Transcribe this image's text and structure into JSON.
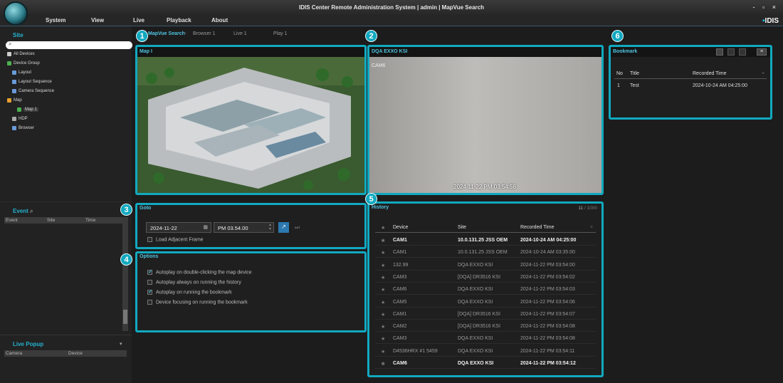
{
  "window": {
    "title": "IDIS Center Remote Administration System | admin | MapVue Search",
    "controls": "- ▫ ×",
    "brand": "IDIS"
  },
  "menu": [
    "System",
    "View",
    "Live",
    "Playback",
    "About"
  ],
  "site": {
    "title": "Site",
    "search_placeholder": "",
    "tree": [
      {
        "label": "All Devices",
        "icon_color": "#cccccc"
      },
      {
        "label": "Device Group",
        "icon_color": "#4caf50"
      },
      {
        "label": "Layout",
        "icon_color": "#6a9ad8"
      },
      {
        "label": "Layout Sequence",
        "icon_color": "#6a9ad8"
      },
      {
        "label": "Camera Sequence",
        "icon_color": "#6a9ad8"
      },
      {
        "label": "Map",
        "icon_color": "#e8a030"
      },
      {
        "label": "Map 1",
        "icon_color": "#4caf50"
      },
      {
        "label": "HDP",
        "icon_color": "#aaaaaa"
      },
      {
        "label": "Browser",
        "icon_color": "#6a9ad8"
      }
    ]
  },
  "event": {
    "title": "Event",
    "columns": [
      "Event",
      "Site",
      "Time"
    ]
  },
  "live_popup": {
    "title": "Live Popup",
    "columns": [
      "Camera",
      "Device"
    ]
  },
  "tabs": [
    "MapVue Search",
    "Browser 1",
    "Live 1",
    "Play 1"
  ],
  "map_panel": {
    "badge": "1",
    "title": "Map I"
  },
  "video_panel": {
    "badge": "2",
    "title": "DQA EXXO KSI",
    "camera_label": "CAM6",
    "timestamp": "2024-11-22 PM 03:54:56"
  },
  "goto_panel": {
    "badge": "3",
    "title": "Goto",
    "date": "2024-11-22",
    "time": "PM 03.54.00",
    "load_adjacent": "Load Adjacent Frame"
  },
  "options_panel": {
    "badge": "4",
    "title": "Options",
    "items": [
      {
        "label": "Autoplay on double-clicking the map device",
        "checked": true
      },
      {
        "label": "Autoplay always on running the history",
        "checked": false
      },
      {
        "label": "Autoplay on running the bookmark",
        "checked": true
      },
      {
        "label": "Device focusing on running the bookmark",
        "checked": false
      }
    ]
  },
  "history_panel": {
    "badge": "5",
    "title": "History",
    "count": "11",
    "total": "/ 1000",
    "columns": [
      "Device",
      "Site",
      "Recorded Time"
    ],
    "rows": [
      {
        "device": "CAM1",
        "site": "10.0.131.25 JSS OEM",
        "time": "2024-10-24 AM 04:25:00",
        "bold": true
      },
      {
        "device": "CAM1",
        "site": "10.0.131.25 JSS OEM",
        "time": "2024-10-24 AM 03:35:00",
        "bold": false
      },
      {
        "device": "132.99",
        "site": "DQA EXXO KSI",
        "time": "2024-11-22 PM 03:54:00",
        "bold": false
      },
      {
        "device": "CAM3",
        "site": "[DQA] DR3516 KSI",
        "time": "2024-11-22 PM 03:54:02",
        "bold": false
      },
      {
        "device": "CAM6",
        "site": "DQA EXXO KSI",
        "time": "2024-11-22 PM 03:54:03",
        "bold": false
      },
      {
        "device": "CAM5",
        "site": "DQA EXXO KSI",
        "time": "2024-11-22 PM 03:54:06",
        "bold": false
      },
      {
        "device": "CAM1",
        "site": "[DQA] DR3516 KSI",
        "time": "2024-11-22 PM 03:54:07",
        "bold": false
      },
      {
        "device": "CAM2",
        "site": "[DQA] DR3516 KSI",
        "time": "2024-11-22 PM 03:54:08",
        "bold": false
      },
      {
        "device": "CAM3",
        "site": "DQA EXXO KSI",
        "time": "2024-11-22 PM 03:54:08",
        "bold": false
      },
      {
        "device": "D4536HRX #1 5459",
        "site": "DQA EXXO KSI",
        "time": "2024-11-22 PM 03:54:11",
        "bold": false
      },
      {
        "device": "CAM6",
        "site": "DQA EXXO KSI",
        "time": "2024-11-22 PM 03:54:12",
        "bold": true
      }
    ]
  },
  "bookmark_panel": {
    "badge": "6",
    "title": "Bookmark",
    "columns": [
      "No",
      "Title",
      "Recorded Time"
    ],
    "rows": [
      {
        "no": "1",
        "title": "Test",
        "time": "2024-10-24 AM 04:25:00"
      }
    ]
  },
  "colors": {
    "accent": "#11a9c0",
    "title_blue": "#24b3d1"
  }
}
